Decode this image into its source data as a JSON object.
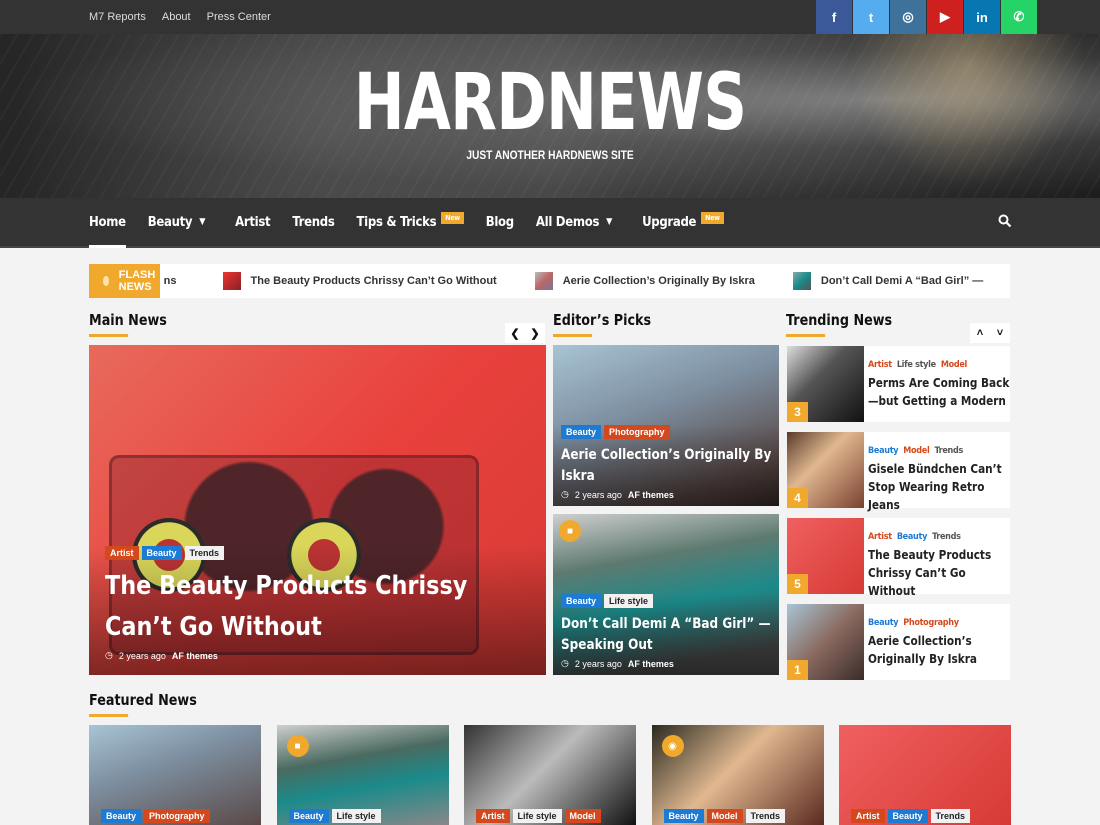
{
  "topbar": {
    "links": [
      "M7 Reports",
      "About",
      "Press Center"
    ],
    "social": [
      {
        "icon": "facebook-icon",
        "glyph": "f",
        "color": "#3b5998"
      },
      {
        "icon": "twitter-icon",
        "glyph": "t",
        "color": "#55acee"
      },
      {
        "icon": "instagram-icon",
        "glyph": "◎",
        "color": "#3f729b"
      },
      {
        "icon": "youtube-icon",
        "glyph": "▶",
        "color": "#cd201f"
      },
      {
        "icon": "linkedin-icon",
        "glyph": "in",
        "color": "#0976b4"
      },
      {
        "icon": "whatsapp-icon",
        "glyph": "✆",
        "color": "#25d366"
      }
    ]
  },
  "header": {
    "logo": "HARDNEWS",
    "tagline": "JUST ANOTHER HARDNEWS SITE"
  },
  "nav": {
    "items": [
      {
        "label": "Home",
        "active": true
      },
      {
        "label": "Beauty",
        "dropdown": true
      },
      {
        "label": "Artist"
      },
      {
        "label": "Trends"
      },
      {
        "label": "Tips & Tricks",
        "badge": "New"
      },
      {
        "label": "Blog"
      },
      {
        "label": "All Demos",
        "dropdown": true
      },
      {
        "label": "Upgrade",
        "badge": "New"
      }
    ],
    "search_icon": "search-icon"
  },
  "ticker": {
    "label": "FLASH NEWS",
    "partial": "ns",
    "items": [
      "The Beauty Products Chrissy Can’t Go Without",
      "Aerie Collection’s Originally By Iskra",
      "Don’t Call Demi A “Bad Girl” —"
    ]
  },
  "sections": {
    "main_news": "Main News",
    "editors_picks": "Editor’s Picks",
    "trending_news": "Trending News",
    "featured_news": "Featured News"
  },
  "colors": {
    "accent": "#f0a92c",
    "topbar": "#333333",
    "cat_orange": "#d4481e",
    "cat_blue": "#1e7bd4"
  },
  "main_feature": {
    "categories": [
      "Artist",
      "Beauty",
      "Trends"
    ],
    "title": "The Beauty Products Chrissy Can’t Go Without",
    "time": "2 years ago",
    "author": "AF themes"
  },
  "editors_picks": [
    {
      "categories": [
        "Beauty",
        "Photography"
      ],
      "title": "Aerie Collection’s Originally By Iskra",
      "time": "2 years ago",
      "author": "AF themes"
    },
    {
      "categories": [
        "Beauty",
        "Life style"
      ],
      "title": "Don’t Call Demi A “Bad Girl” — Speaking Out",
      "time": "2 years ago",
      "author": "AF themes",
      "media": "video"
    }
  ],
  "trending": [
    {
      "rank": "3",
      "categories": [
        "Artist",
        "Life style",
        "Model"
      ],
      "title": "Perms Are Coming Back—but Getting a Modern"
    },
    {
      "rank": "4",
      "categories": [
        "Beauty",
        "Model",
        "Trends"
      ],
      "title": "Gisele Bündchen Can’t Stop Wearing Retro Jeans"
    },
    {
      "rank": "5",
      "categories": [
        "Artist",
        "Beauty",
        "Trends"
      ],
      "title": "The Beauty Products Chrissy Can’t Go Without"
    },
    {
      "rank": "1",
      "categories": [
        "Beauty",
        "Photography"
      ],
      "title": "Aerie Collection’s Originally By Iskra"
    }
  ],
  "featured": [
    {
      "categories": [
        "Beauty",
        "Photography"
      ]
    },
    {
      "categories": [
        "Beauty",
        "Life style"
      ],
      "media": "video"
    },
    {
      "categories": [
        "Artist",
        "Life style",
        "Model"
      ]
    },
    {
      "categories": [
        "Beauty",
        "Model",
        "Trends"
      ],
      "media": "gallery"
    },
    {
      "categories": [
        "Artist",
        "Beauty",
        "Trends"
      ]
    }
  ]
}
